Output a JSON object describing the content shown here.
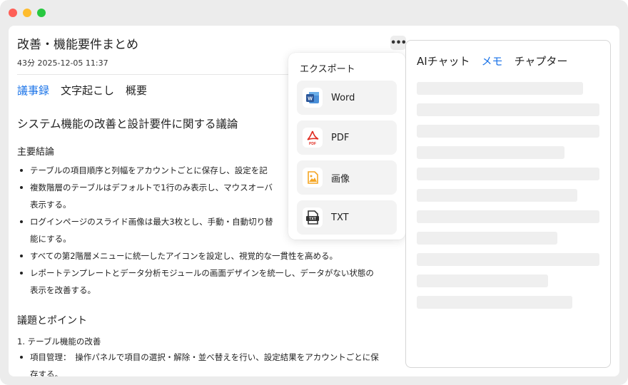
{
  "window": {
    "traffic_lights": {
      "close": "#fe5f57",
      "minimize": "#febc2e",
      "zoom": "#28c840"
    }
  },
  "doc": {
    "title": "改善・機能要件まとめ",
    "meta": "43分  2025-12-05 11:37",
    "more_label": "•••",
    "tabs": [
      {
        "label": "議事録",
        "active": true
      },
      {
        "label": "文字起こし",
        "active": false
      },
      {
        "label": "概要",
        "active": false
      }
    ],
    "heading": "システム機能の改善と設計要件に関する議論",
    "conclusions_title": "主要結論",
    "conclusions": [
      "テーブルの項目順序と列幅をアカウントごとに保存し、設定を記",
      "複数階層のテーブルはデフォルトで1行のみ表示し、マウスオーバ",
      "表示する。",
      "ログインページのスライド画像は最大3枚とし、手動・自動切り替",
      "能にする。",
      "すべての第2階層メニューに統一したアイコンを設定し、視覚的な一貫性を高める。",
      "レポートテンプレートとデータ分析モジュールの画面デザインを統一し、データがない状態の",
      "表示を改善する。"
    ],
    "topics_title": "議題とポイント",
    "topic_1": "1. テーブル機能の改善",
    "topic_1_bullets": [
      "項目管理：　操作パネルで項目の選択・解除・並べ替えを行い、設定結果をアカウントごとに保",
      "存する。"
    ]
  },
  "export_menu": {
    "title": "エクスポート",
    "items": [
      {
        "label": "Word",
        "icon": "word-icon"
      },
      {
        "label": "PDF",
        "icon": "pdf-icon"
      },
      {
        "label": "画像",
        "icon": "image-icon"
      },
      {
        "label": "TXT",
        "icon": "txt-icon"
      }
    ]
  },
  "side_panel": {
    "tabs": [
      {
        "label": "AIチャット",
        "active": false
      },
      {
        "label": "メモ",
        "active": true
      },
      {
        "label": "チャプター",
        "active": false
      }
    ],
    "skeleton_line_fractions": [
      0.91,
      1.0,
      1.0,
      0.81,
      1.0,
      0.88,
      1.0,
      0.77,
      1.0,
      0.72,
      0.85
    ]
  },
  "colors": {
    "accent": "#1a73e8",
    "word": "#2b579a",
    "pdf": "#e02b20",
    "image": "#f5a623",
    "txt": "#333333"
  }
}
